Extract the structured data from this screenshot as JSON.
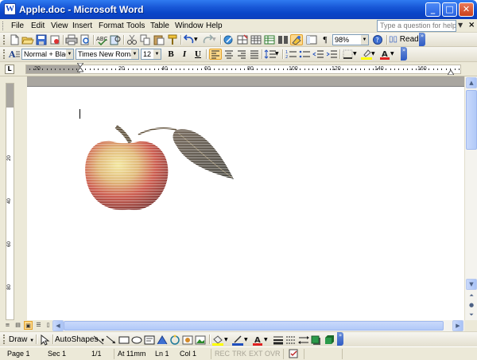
{
  "window": {
    "title": "Apple.doc - Microsoft Word",
    "controls": [
      "minimize-icon",
      "maximize-icon",
      "close-icon"
    ]
  },
  "menu": {
    "items": [
      "File",
      "Edit",
      "View",
      "Insert",
      "Format",
      "Tools",
      "Table",
      "Window",
      "Help"
    ],
    "help_placeholder": "Type a question for help"
  },
  "standard_toolbar": {
    "zoom": "98%",
    "read_label": "Read",
    "pilcrow": "¶"
  },
  "formatting_toolbar": {
    "style": "Normal + Black",
    "font": "Times New Roman",
    "size": "12",
    "bold": "B",
    "italic": "I",
    "underline": "U"
  },
  "ruler": {
    "labels": [
      "20",
      "20",
      "40",
      "60",
      "80",
      "100",
      "120",
      "140",
      "160"
    ]
  },
  "vertical_ruler": {
    "labels": [
      "20",
      "40",
      "60",
      "80"
    ]
  },
  "drawing_toolbar": {
    "draw_label": "Draw",
    "autoshapes_label": "AutoShapes"
  },
  "statusbar": {
    "page": "Page  1",
    "sec": "Sec  1",
    "pages": "1/1",
    "at": "At  11mm",
    "ln": "Ln  1",
    "col": "Col  1",
    "rec": "REC",
    "trk": "TRK",
    "ext": "EXT",
    "ovr": "OVR"
  },
  "colors": {
    "titlebar": "#0a45c8",
    "chrome": "#ece9d8",
    "highlight": "#ffd98a",
    "font_color": "#e02020",
    "highlight_color": "#ffff00"
  }
}
